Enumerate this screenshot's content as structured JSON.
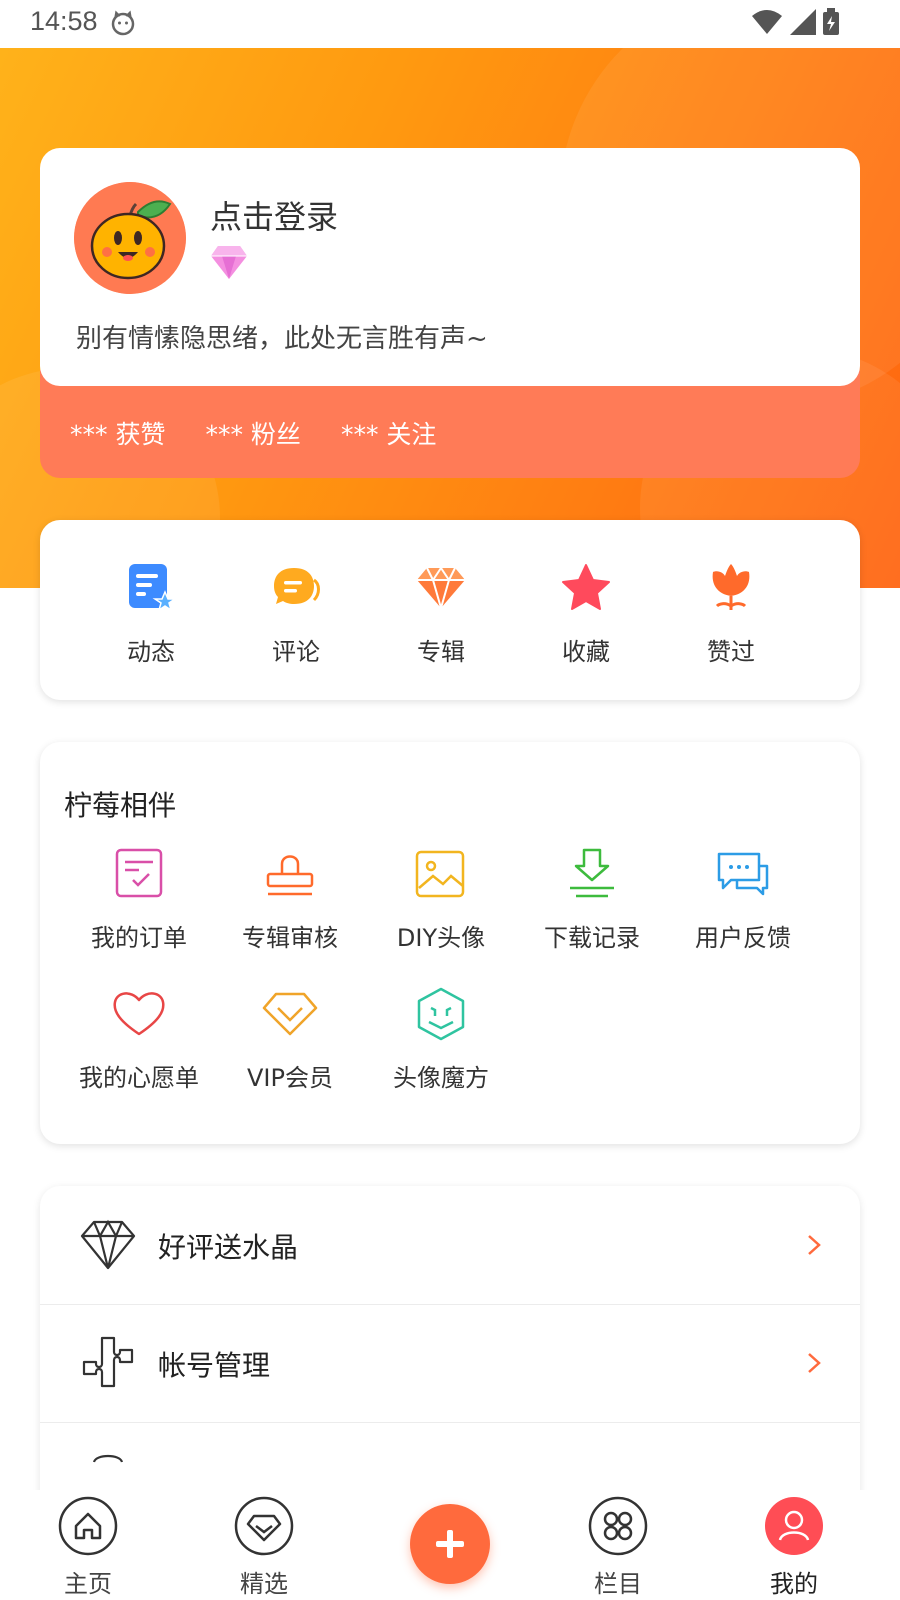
{
  "status_bar": {
    "time": "14:58"
  },
  "profile": {
    "login_prompt": "点击登录",
    "motto": "别有情愫隐思绪，此处无言胜有声~",
    "stats": [
      {
        "value": "***",
        "label": "获赞"
      },
      {
        "value": "***",
        "label": "粉丝"
      },
      {
        "value": "***",
        "label": "关注"
      }
    ]
  },
  "quick_actions": [
    {
      "label": "动态",
      "icon": "dynamic-icon"
    },
    {
      "label": "评论",
      "icon": "comment-icon"
    },
    {
      "label": "专辑",
      "icon": "album-icon"
    },
    {
      "label": "收藏",
      "icon": "star-icon"
    },
    {
      "label": "赞过",
      "icon": "tulip-icon"
    }
  ],
  "services": {
    "title": "柠莓相伴",
    "items": [
      {
        "label": "我的订单",
        "icon": "order-icon"
      },
      {
        "label": "专辑审核",
        "icon": "stamp-icon"
      },
      {
        "label": "DIY头像",
        "icon": "image-icon"
      },
      {
        "label": "下载记录",
        "icon": "download-icon"
      },
      {
        "label": "用户反馈",
        "icon": "feedback-icon"
      },
      {
        "label": "我的心愿单",
        "icon": "heart-icon"
      },
      {
        "label": "VIP会员",
        "icon": "vip-diamond-icon"
      },
      {
        "label": "头像魔方",
        "icon": "cube-icon"
      }
    ]
  },
  "settings_list": [
    {
      "label": "好评送水晶",
      "icon": "crystal-icon"
    },
    {
      "label": "帐号管理",
      "icon": "account-icon"
    }
  ],
  "bottom_nav": {
    "items": [
      {
        "label": "主页",
        "icon": "home-icon"
      },
      {
        "label": "精选",
        "icon": "featured-icon"
      },
      {
        "label": "栏目",
        "icon": "category-icon"
      },
      {
        "label": "我的",
        "icon": "user-icon"
      }
    ],
    "active": "我的"
  },
  "colors": {
    "accent": "#ff6a3d",
    "hero_start": "#ffb21a",
    "hero_end": "#ff6410",
    "stats_bar": "#ff7b57",
    "active_nav": "#ff4d55"
  }
}
